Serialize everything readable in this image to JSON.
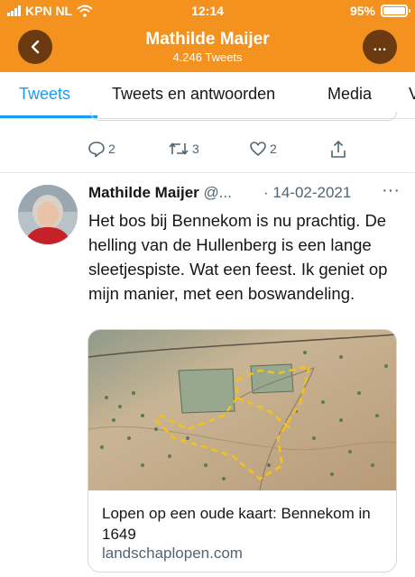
{
  "status_bar": {
    "carrier": "KPN NL",
    "time": "12:14",
    "battery": "95%"
  },
  "header": {
    "title": "Mathilde Maijer",
    "tweet_count": "4.246 Tweets",
    "back_icon": "chevron-left-icon",
    "more_label": "…"
  },
  "tabs": [
    {
      "label": "Tweets",
      "active": true
    },
    {
      "label": "Tweets en antwoorden",
      "active": false
    },
    {
      "label": "Media",
      "active": false
    },
    {
      "label": "V",
      "active": false
    }
  ],
  "previous_tweet": {
    "replies": "2",
    "retweets": "3",
    "likes": "2"
  },
  "tweet": {
    "display_name": "Mathilde Maijer",
    "handle": "@...",
    "date": "· 14-02-2021",
    "more_label": "···",
    "text": "Het bos bij Bennekom is nu prachtig. De helling van de Hullenberg is een lange sleetjespiste. Wat een feest. Ik geniet op mijn manier, met een boswandeling.",
    "card": {
      "title": "Lopen op een oude kaart: Bennekom in 1649",
      "domain": "landschaplopen.com"
    }
  },
  "colors": {
    "header_bg": "#f3921f",
    "round_button_bg": "#6b3a10",
    "accent": "#1d9bf0",
    "muted_text": "#536471"
  }
}
